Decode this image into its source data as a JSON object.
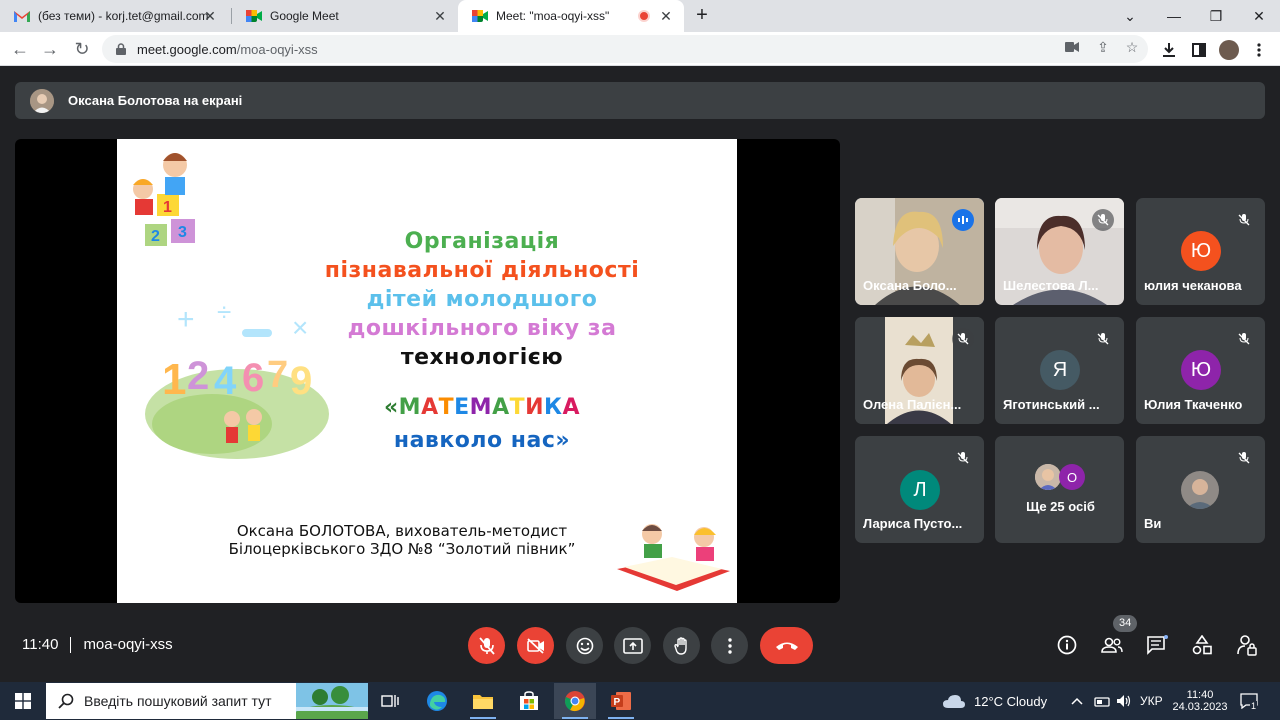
{
  "browser": {
    "tabs": [
      {
        "title": "(без теми) - korj.tet@gmail.com",
        "icon": "gmail-icon"
      },
      {
        "title": "Google Meet",
        "icon": "meet-icon"
      },
      {
        "title": "Meet: \"moa-oqyi-xss\"",
        "icon": "meet-icon",
        "active": true,
        "recording": true
      }
    ],
    "url_host": "meet.google.com",
    "url_path": "/moa-oqyi-xss"
  },
  "meet": {
    "presenting_banner": "Оксана Болотова на екрані",
    "slide": {
      "title_lines": [
        {
          "text": "Організація",
          "color": "#4caf50"
        },
        {
          "text": "пізнавальної діяльності",
          "color": "#f4511e"
        },
        {
          "text": "дітей молодшого",
          "color": "#5bc0eb"
        },
        {
          "text": "дошкільного віку за",
          "color": "#d47ad4"
        },
        {
          "text": "технологією",
          "color": "#111111"
        }
      ],
      "project_title_open": "«",
      "project_title_word": "МАТЕМАТИКА",
      "project_title_line2": "навколо нас»",
      "author_line1": "Оксана БОЛОТОВА, вихователь-методист",
      "author_line2": "Білоцерківського ЗДО №8 “Золотий півник”"
    },
    "participants": [
      {
        "name": "Оксана Боло...",
        "type": "video",
        "speaking": true
      },
      {
        "name": "Шелестова Л...",
        "type": "video",
        "muted": true
      },
      {
        "name": "юлия чеканова",
        "type": "avatar",
        "initial": "Ю",
        "color": "#f4511e",
        "muted": true
      },
      {
        "name": "Олена Палієн...",
        "type": "video",
        "muted": true
      },
      {
        "name": "Яготинський ...",
        "type": "avatar",
        "initial": "Я",
        "color": "#455a64",
        "muted": true
      },
      {
        "name": "Юлия Ткаченко",
        "type": "avatar",
        "initial": "Ю",
        "color": "#8e24aa",
        "muted": true
      },
      {
        "name": "Лариса Пусто...",
        "type": "avatar",
        "initial": "Л",
        "color": "#00897b",
        "muted": true
      },
      {
        "name": "Ще 25 осіб",
        "type": "more",
        "extra_initial": "О",
        "extra_color": "#8e24aa"
      },
      {
        "name": "Ви",
        "type": "self",
        "muted": true
      }
    ],
    "time": "11:40",
    "meeting_code": "moa-oqyi-xss",
    "people_count": "34"
  },
  "taskbar": {
    "search_placeholder": "Введіть пошуковий запит тут",
    "weather": "12°C  Cloudy",
    "lang": "УКР",
    "clock_time": "11:40",
    "clock_date": "24.03.2023",
    "notif_count": "1"
  },
  "colors": {
    "accent": "#8ab4f8",
    "danger": "#ea4335",
    "tile": "#3c4043",
    "bg": "#202124"
  }
}
